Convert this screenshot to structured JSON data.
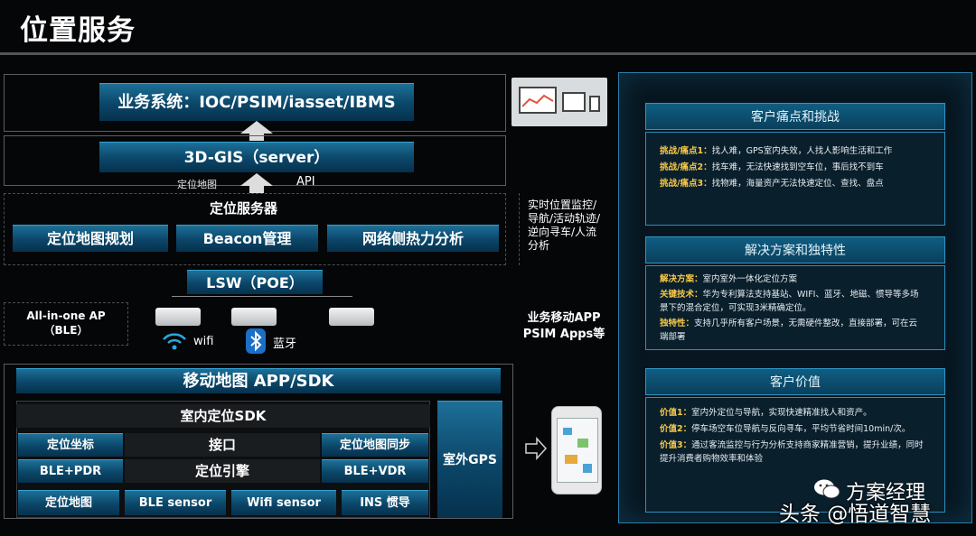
{
  "title": "位置服务",
  "biz_system": "业务系统：IOC/PSIM/iasset/IBMS",
  "gis_server": "3D-GIS（server）",
  "label_map": "定位地图",
  "label_api": "API",
  "location_server": "定位服务器",
  "modules": [
    "定位地图规划",
    "Beacon管理",
    "网络侧热力分析"
  ],
  "realtime_note": "实时位置监控/导航/活动轨迹/逆向寻车/人流分析",
  "lsw": "LSW（POE）",
  "all_in_one": "All-in-one AP（BLE）",
  "wifi": "wifi",
  "bluetooth": "蓝牙",
  "mobile_app": "业务移动APP PSIM Apps等",
  "sdk_title": "移动地图 APP/SDK",
  "indoor_sdk": "室内定位SDK",
  "sdk_row1": [
    "定位坐标",
    "接口",
    "定位地图同步"
  ],
  "sdk_row2": [
    "BLE+PDR",
    "定位引擎",
    "BLE+VDR"
  ],
  "sdk_row3": [
    "定位地图",
    "BLE sensor",
    "Wifi sensor",
    "INS 惯导"
  ],
  "outdoor_gps": "室外GPS",
  "right": {
    "s1_title": "客户痛点和挑战",
    "s1_items": [
      {
        "k": "挑战/痛点1：",
        "v": "找人难，GPS室内失效，人找人影响生活和工作"
      },
      {
        "k": "挑战/痛点2：",
        "v": "找车难，无法快速找到空车位，事后找不到车"
      },
      {
        "k": "挑战/痛点3：",
        "v": "找物难，海量资产无法快速定位、查找、盘点"
      }
    ],
    "s2_title": "解决方案和独特性",
    "s2_items": [
      {
        "k": "解决方案：",
        "v": "室内室外一体化定位方案"
      },
      {
        "k": "关键技术：",
        "v": "华为专利算法支持基站、WIFI、蓝牙、地磁、惯导等多场"
      },
      {
        "k": "",
        "v": "景下的混合定位，可实现3米精确定位。"
      },
      {
        "k": "独特性：",
        "v": "支持几乎所有客户场景，无需硬件整改，直接部署，可在云"
      },
      {
        "k": "",
        "v": "端部署"
      }
    ],
    "s3_title": "客户价值",
    "s3_items": [
      {
        "k": "价值1：",
        "v": "室内外定位与导航，实现快速精准找人和资产。"
      },
      {
        "k": "价值2：",
        "v": "停车场空车位导航与反向寻车，平均节省时间10min/次。"
      },
      {
        "k": "价值3：",
        "v": "通过客流监控与行为分析支持商家精准营销，提升业绩，同时"
      },
      {
        "k": "",
        "v": "提升消费者购物效率和体验"
      }
    ]
  },
  "watermark1": "方案经理",
  "watermark2": "头条 @悟道智慧",
  "colors": {
    "accent": "#0b4668",
    "highlight": "#f7c948",
    "panel_border": "#2b7fa9"
  }
}
